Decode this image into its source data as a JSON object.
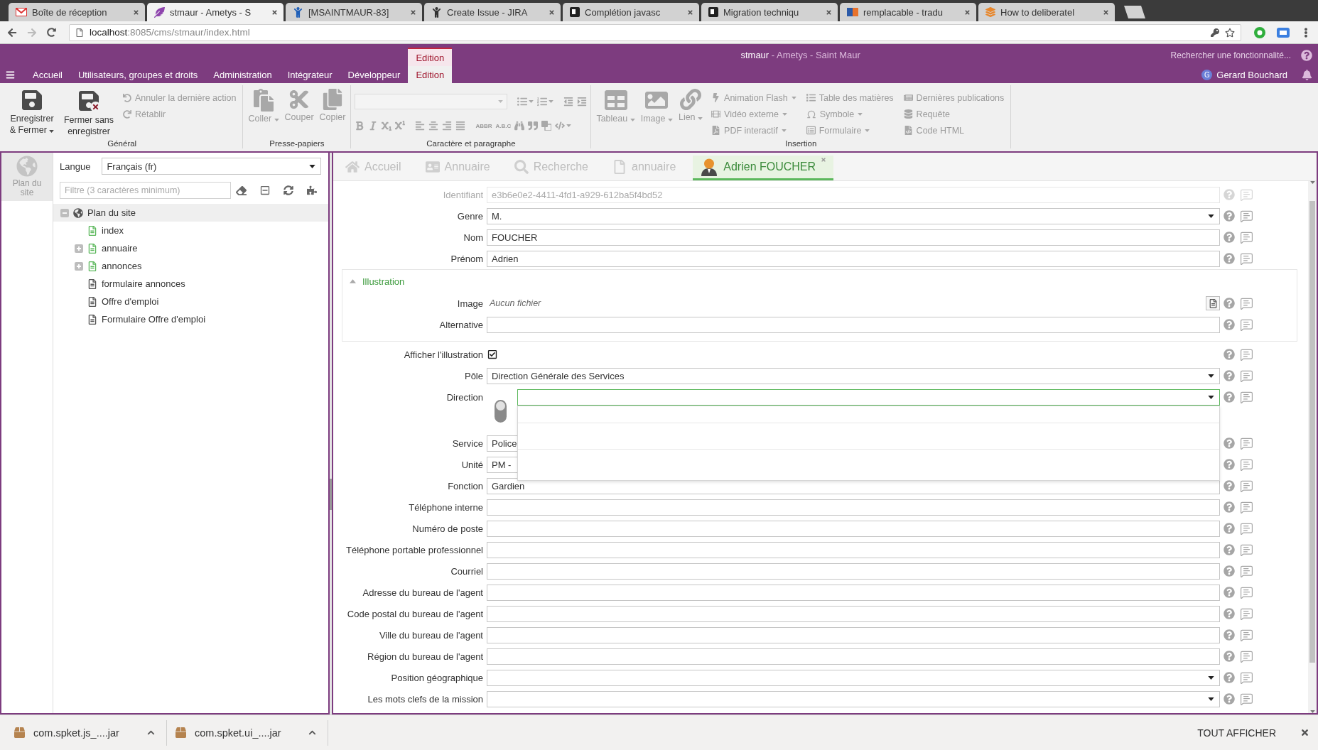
{
  "browser": {
    "tabs": [
      {
        "title": "Boîte de réception",
        "selected": false
      },
      {
        "title": "stmaur - Ametys - S",
        "selected": true
      },
      {
        "title": "[MSAINTMAUR-83]",
        "selected": false
      },
      {
        "title": "Create Issue - JIRA",
        "selected": false
      },
      {
        "title": "Complétion javasc",
        "selected": false
      },
      {
        "title": "Migration techniqu",
        "selected": false
      },
      {
        "title": "remplacable - tradu",
        "selected": false
      },
      {
        "title": "How to deliberatel",
        "selected": false
      }
    ],
    "address": {
      "host": "localhost",
      "path": ":8085/cms/stmaur/index.html"
    }
  },
  "header": {
    "menu_tabs": [
      {
        "label": "Accueil",
        "selected": false
      },
      {
        "label": "Utilisateurs, groupes et droits",
        "selected": false
      },
      {
        "label": "Administration",
        "selected": false
      },
      {
        "label": "Intégrateur",
        "selected": false
      },
      {
        "label": "Développeur",
        "selected": false
      }
    ],
    "context_group": {
      "label": "Edition",
      "tabs": [
        {
          "label": "Edition",
          "selected": true
        }
      ]
    },
    "title": {
      "site": "stmaur",
      "app": "- Ametys - Saint Maur"
    },
    "search": {
      "placeholder": "Rechercher une fonctionnalité..."
    },
    "user": {
      "initial": "G",
      "name": "Gerard Bouchard"
    }
  },
  "ribbon": {
    "groups": [
      {
        "label": "Général",
        "buttons": [
          {
            "kind": "large",
            "label": "Enregistrer & Fermer",
            "dropdown": true,
            "disabled": false
          },
          {
            "kind": "large",
            "label": "Fermer sans enregistrer",
            "dropdown": false,
            "disabled": false
          },
          {
            "kind": "small",
            "label": "Annuler la dernière action",
            "dropdown": false,
            "disabled": true
          },
          {
            "kind": "small",
            "label": "Rétablir",
            "dropdown": false,
            "disabled": true
          }
        ]
      },
      {
        "label": "Presse-papiers",
        "buttons": [
          {
            "kind": "large",
            "label": "Coller",
            "dropdown": true,
            "disabled": true
          },
          {
            "kind": "large",
            "label": "Couper",
            "dropdown": false,
            "disabled": true
          },
          {
            "kind": "large",
            "label": "Copier",
            "dropdown": false,
            "disabled": true
          }
        ]
      },
      {
        "label": "Caractère et paragraphe",
        "rows": [
          [
            [
              {
                "kind": "font-field",
                "disabled": true
              }
            ],
            [
              {
                "kind": "icon",
                "dropdown": true,
                "disabled": true
              },
              {
                "kind": "icon",
                "dropdown": true,
                "disabled": true
              }
            ],
            [
              {
                "kind": "icon",
                "dropdown": false,
                "disabled": true
              },
              {
                "kind": "icon",
                "dropdown": false,
                "disabled": true
              }
            ]
          ],
          [
            [
              {
                "kind": "icon",
                "dropdown": false,
                "disabled": true
              },
              {
                "kind": "icon",
                "dropdown": false,
                "disabled": true
              },
              {
                "kind": "icon",
                "dropdown": false,
                "disabled": true
              },
              {
                "kind": "icon",
                "dropdown": false,
                "disabled": true
              }
            ],
            [
              {
                "kind": "icon",
                "dropdown": false,
                "disabled": true
              },
              {
                "kind": "icon",
                "dropdown": false,
                "disabled": true
              },
              {
                "kind": "icon",
                "dropdown": false,
                "disabled": true
              },
              {
                "kind": "icon",
                "dropdown": false,
                "disabled": true
              }
            ],
            [
              {
                "kind": "text",
                "label": "ABBR",
                "dropdown": false,
                "disabled": true
              },
              {
                "kind": "text",
                "label": "A.B.C",
                "dropdown": false,
                "disabled": true
              },
              {
                "kind": "icon",
                "dropdown": false,
                "disabled": true
              },
              {
                "kind": "icon",
                "dropdown": false,
                "disabled": true
              },
              {
                "kind": "icon",
                "dropdown": false,
                "disabled": true
              },
              {
                "kind": "icon",
                "dropdown": true,
                "disabled": true
              }
            ]
          ]
        ]
      },
      {
        "label": "Insertion",
        "buttons": [
          {
            "kind": "large",
            "label": "Tableau",
            "dropdown": true,
            "disabled": true
          },
          {
            "kind": "large",
            "label": "Image",
            "dropdown": true,
            "disabled": true
          },
          {
            "kind": "large",
            "label": "Lien",
            "dropdown": true,
            "disabled": true
          },
          {
            "kind": "small",
            "label": "Animation Flash",
            "dropdown": true,
            "disabled": true
          },
          {
            "kind": "small",
            "label": "Vidéo externe",
            "dropdown": true,
            "disabled": true
          },
          {
            "kind": "small",
            "label": "PDF interactif",
            "dropdown": true,
            "disabled": true
          },
          {
            "kind": "small",
            "label": "Table des matières",
            "dropdown": false,
            "disabled": true
          },
          {
            "kind": "small",
            "label": "Symbole",
            "dropdown": true,
            "disabled": true
          },
          {
            "kind": "small",
            "label": "Formulaire",
            "dropdown": true,
            "disabled": true
          },
          {
            "kind": "small",
            "label": "Dernières publications",
            "dropdown": false,
            "disabled": true
          },
          {
            "kind": "small",
            "label": "Requête",
            "dropdown": false,
            "disabled": true
          },
          {
            "kind": "small",
            "label": "Code HTML",
            "dropdown": false,
            "disabled": true
          }
        ]
      }
    ]
  },
  "sidebar": {
    "tabs": [
      {
        "label": "Plan du site",
        "selected": true
      }
    ]
  },
  "sitemap": {
    "language": {
      "label": "Langue",
      "value": "Français (fr)"
    },
    "filter": {
      "placeholder": "Filtre (3 caractères minimum)"
    },
    "tree": [
      {
        "kind": "site",
        "label": "Plan du site",
        "selected": true,
        "expanded": true,
        "children": [
          {
            "kind": "page",
            "label": "index",
            "color": "#5cb85c",
            "selected": false
          },
          {
            "kind": "page",
            "label": "annuaire",
            "color": "#5cb85c",
            "selected": false,
            "expanded": false
          },
          {
            "kind": "page",
            "label": "annonces",
            "color": "#5cb85c",
            "selected": false,
            "expanded": false
          },
          {
            "kind": "page",
            "label": "formulaire annonces",
            "color": "#555555",
            "selected": false
          },
          {
            "kind": "page",
            "label": "Offre d'emploi",
            "color": "#555555",
            "selected": false
          },
          {
            "kind": "page",
            "label": "Formulaire Offre d'emploi",
            "color": "#555555",
            "selected": false
          }
        ]
      }
    ]
  },
  "editor": {
    "tabs": [
      {
        "label": "Accueil",
        "selected": false
      },
      {
        "label": "Annuaire",
        "selected": false
      },
      {
        "label": "Recherche",
        "selected": false
      },
      {
        "label": "annuaire",
        "selected": false
      },
      {
        "label": "Adrien FOUCHER",
        "selected": true
      }
    ],
    "fields": [
      {
        "kind": "text",
        "label": "Identifiant",
        "value": "e3b6e0e2-4411-4fd1-a929-612ba5f4bd52",
        "disabled": true,
        "focused": false
      },
      {
        "kind": "select",
        "label": "Genre",
        "value": "M.",
        "disabled": false,
        "focused": false,
        "open": false
      },
      {
        "kind": "text",
        "label": "Nom",
        "value": "FOUCHER",
        "disabled": false,
        "focused": false
      },
      {
        "kind": "text",
        "label": "Prénom",
        "value": "Adrien",
        "disabled": false,
        "focused": false
      },
      {
        "kind": "section",
        "title": "Illustration",
        "expanded": true,
        "fields": [
          {
            "kind": "file",
            "label": "Image",
            "value": "Aucun fichier",
            "disabled": false
          },
          {
            "kind": "text",
            "label": "Alternative",
            "disabled": false,
            "focused": false
          }
        ]
      },
      {
        "kind": "checkbox",
        "label": "Afficher l'illustration",
        "checked": true,
        "disabled": false
      },
      {
        "kind": "select",
        "label": "Pôle",
        "value": "Direction Générale des Services",
        "disabled": false,
        "focused": false,
        "open": false
      },
      {
        "kind": "select",
        "label": "Direction",
        "disabled": false,
        "focused": true,
        "open": true
      },
      {
        "kind": "text",
        "label": "Service",
        "value": "Police",
        "disabled": false,
        "focused": false
      },
      {
        "kind": "text",
        "label": "Unité",
        "value": "PM -",
        "disabled": false,
        "focused": false
      },
      {
        "kind": "text",
        "label": "Fonction",
        "value": "Gardien",
        "disabled": false,
        "focused": false
      },
      {
        "kind": "text",
        "label": "Téléphone interne",
        "disabled": false,
        "focused": false
      },
      {
        "kind": "text",
        "label": "Numéro de poste",
        "disabled": false,
        "focused": false
      },
      {
        "kind": "text",
        "label": "Téléphone portable professionnel",
        "disabled": false,
        "focused": false
      },
      {
        "kind": "text",
        "label": "Courriel",
        "disabled": false,
        "focused": false
      },
      {
        "kind": "text",
        "label": "Adresse du bureau de l'agent",
        "disabled": false,
        "focused": false
      },
      {
        "kind": "text",
        "label": "Code postal du bureau de l'agent",
        "disabled": false,
        "focused": false
      },
      {
        "kind": "text",
        "label": "Ville du bureau de l'agent",
        "disabled": false,
        "focused": false
      },
      {
        "kind": "text",
        "label": "Région du bureau de l'agent",
        "disabled": false,
        "focused": false
      },
      {
        "kind": "select",
        "label": "Position géographique",
        "disabled": false,
        "focused": false,
        "open": false
      },
      {
        "kind": "select",
        "label": "Les mots clefs de la mission",
        "disabled": false,
        "focused": false,
        "open": false
      }
    ]
  },
  "downloads": {
    "items": [
      {
        "name": "com.spket.js_....jar"
      },
      {
        "name": "com.spket.ui_....jar"
      }
    ],
    "show_all": "TOUT AFFICHER"
  }
}
